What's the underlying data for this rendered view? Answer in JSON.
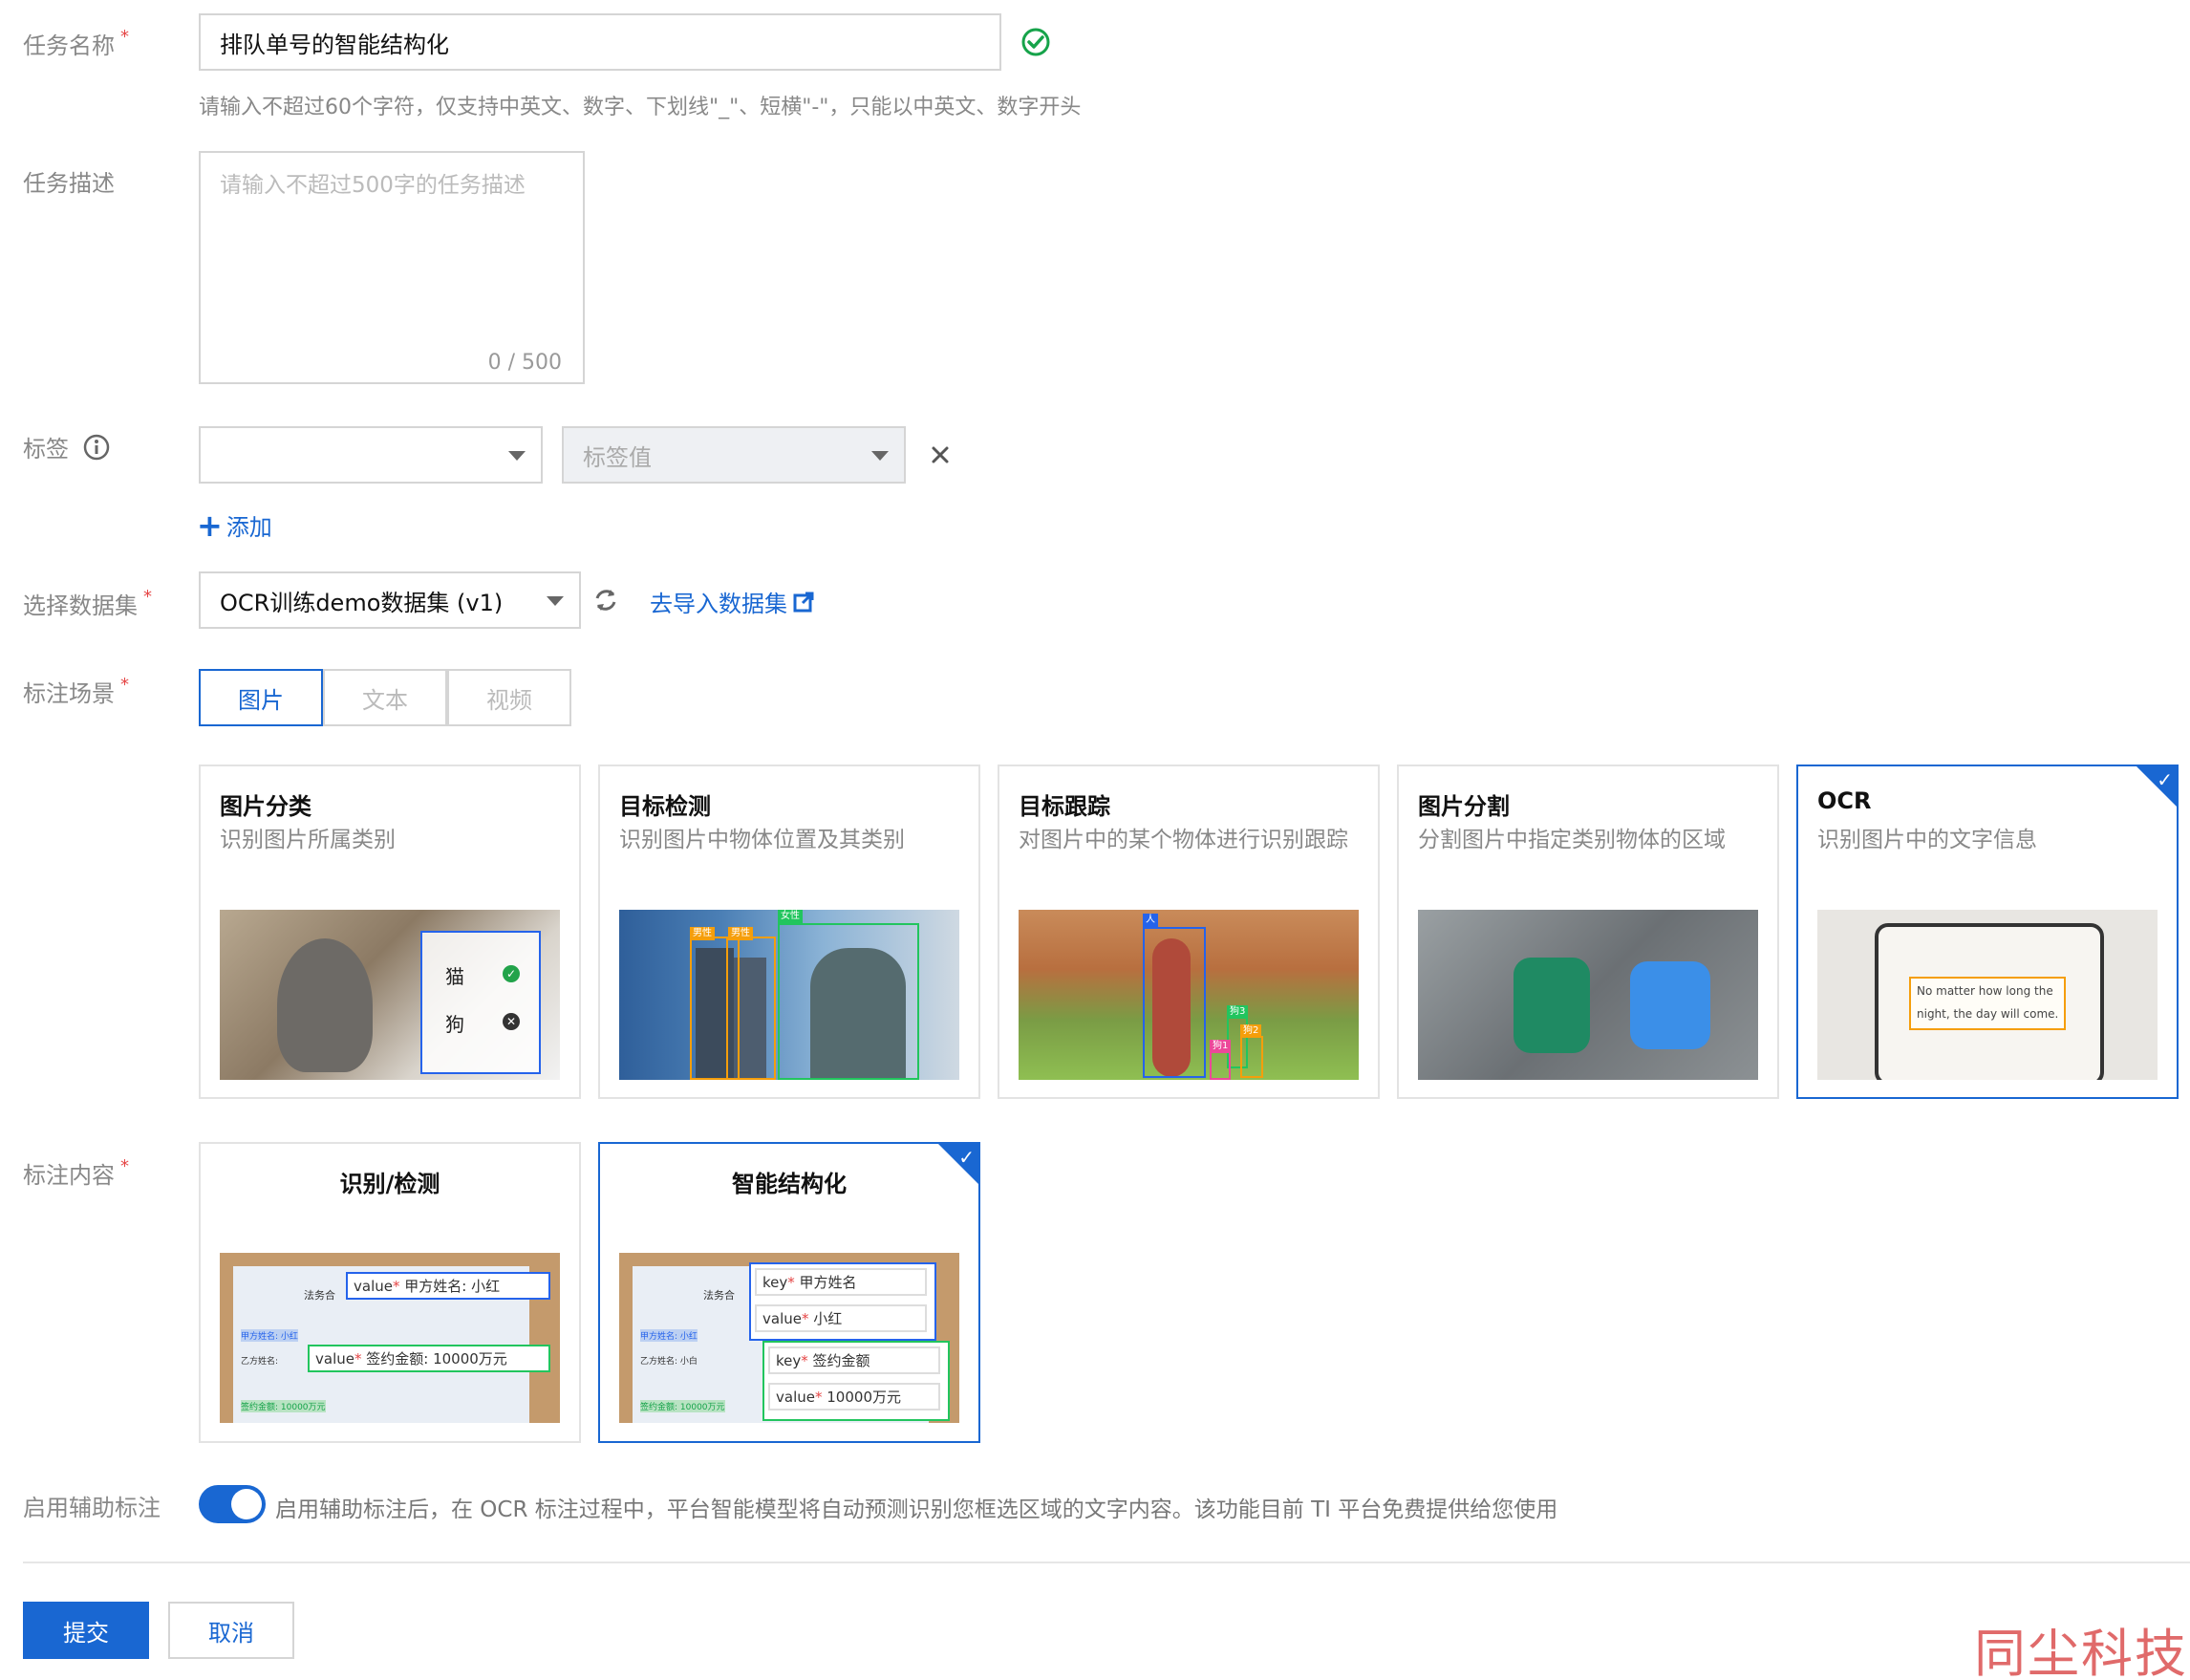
{
  "form": {
    "task_name": {
      "label": "任务名称",
      "value": "排队单号的智能结构化",
      "hint": "请输入不超过60个字符，仅支持中英文、数字、下划线\"_\"、短横\"-\"，只能以中英文、数字开头"
    },
    "task_desc": {
      "label": "任务描述",
      "placeholder": "请输入不超过500字的任务描述",
      "counter": "0 / 500"
    },
    "tags": {
      "label": "标签",
      "key_value": "",
      "value_placeholder": "标签值",
      "add_label": "添加"
    },
    "dataset": {
      "label": "选择数据集",
      "value": "OCR训练demo数据集 (v1)",
      "import_link": "去导入数据集"
    },
    "scene": {
      "label": "标注场景",
      "tabs": [
        "图片",
        "文本",
        "视频"
      ],
      "selected": "图片"
    },
    "scene_cards": [
      {
        "title": "图片分类",
        "desc": "识别图片所属类别",
        "img_labels": [
          "猫",
          "狗"
        ],
        "selected": false
      },
      {
        "title": "目标检测",
        "desc": "识别图片中物体位置及其类别",
        "img_labels": [
          "男性",
          "男性",
          "女性"
        ],
        "selected": false
      },
      {
        "title": "目标跟踪",
        "desc": "对图片中的某个物体进行识别跟踪",
        "img_labels": [
          "人",
          "狗3",
          "狗2",
          "狗1"
        ],
        "selected": false
      },
      {
        "title": "图片分割",
        "desc": "分割图片中指定类别物体的区域",
        "selected": false
      },
      {
        "title": "OCR",
        "desc": "识别图片中的文字信息",
        "img_text": [
          "No matter how long the",
          "night, the day will come."
        ],
        "selected": true
      }
    ],
    "content": {
      "label": "标注内容",
      "cards": [
        {
          "title": "识别/检测",
          "selected": false,
          "doc": {
            "line1": "法务合",
            "line2": "甲方姓名: 小红",
            "line3": "乙方姓名:",
            "line4": "签约金额: 10000万元"
          },
          "fields": [
            {
              "key": "value",
              "val": "甲方姓名: 小红"
            },
            {
              "key": "value",
              "val": "签约金额: 10000万元"
            }
          ]
        },
        {
          "title": "智能结构化",
          "selected": true,
          "doc": {
            "line1": "法务合",
            "line2": "甲方姓名: 小红",
            "line3": "乙方姓名: 小白",
            "line4": "签约金额: 10000万元"
          },
          "fields": [
            {
              "key": "key",
              "val": "甲方姓名"
            },
            {
              "key": "value",
              "val": "小红"
            },
            {
              "key": "key",
              "val": "签约金额"
            },
            {
              "key": "value",
              "val": "10000万元"
            }
          ]
        }
      ]
    },
    "assist": {
      "label": "启用辅助标注",
      "enabled": true,
      "text": "启用辅助标注后，在 OCR 标注过程中，平台智能模型将自动预测识别您框选区域的文字内容。该功能目前 TI 平台免费提供给您使用"
    },
    "actions": {
      "submit": "提交",
      "cancel": "取消"
    }
  },
  "watermark": "同尘科技",
  "colors": {
    "primary": "#1967d2",
    "required": "#e54545",
    "success": "#16a34a",
    "watermark": "#e06a6a"
  }
}
